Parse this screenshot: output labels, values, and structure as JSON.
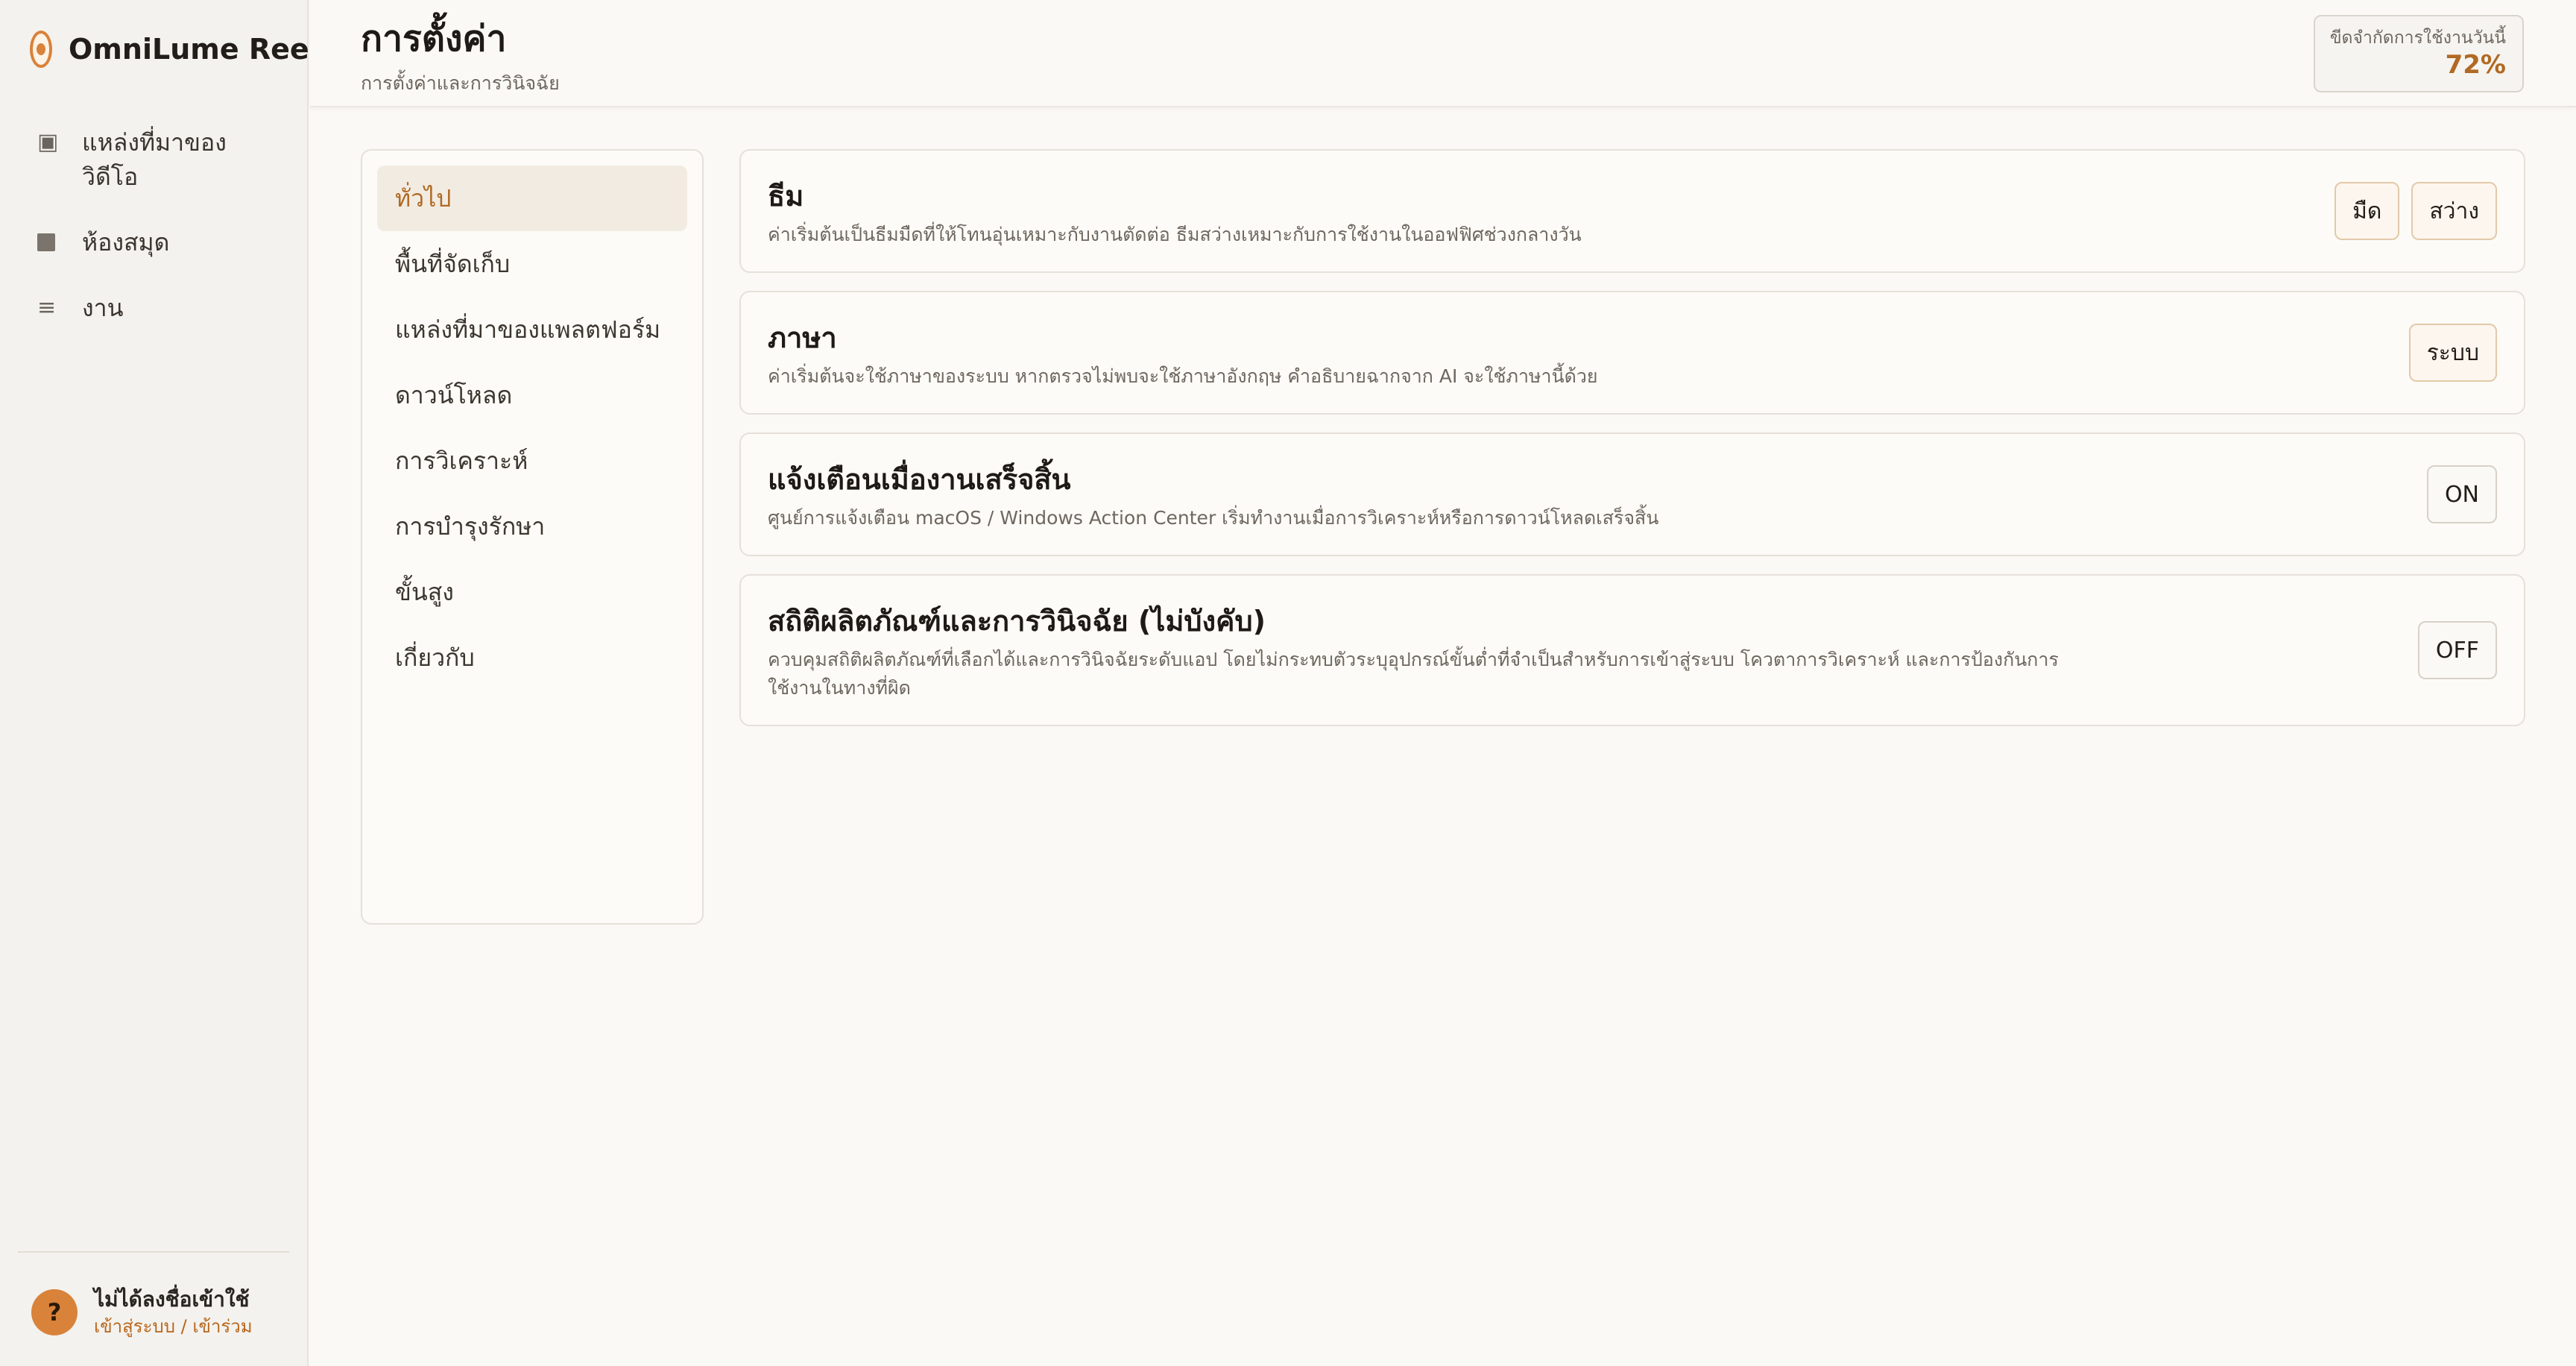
{
  "app": {
    "name": "OmniLume Reel"
  },
  "sidebar": {
    "items": [
      {
        "label": "แหล่งที่มาของวิดีโอ",
        "icon": "video-source-icon"
      },
      {
        "label": "ห้องสมุด",
        "icon": "library-icon"
      },
      {
        "label": "งาน",
        "icon": "tasks-icon"
      }
    ],
    "user": {
      "avatar": "?",
      "name": "ไม่ได้ลงชื่อเข้าใช้",
      "link": "เข้าสู่ระบบ / เข้าร่วม"
    }
  },
  "header": {
    "title": "การตั้งค่า",
    "subtitle": "การตั้งค่าและการวินิจฉัย",
    "quota_label": "ขีดจำกัดการใช้งานวันนี้",
    "quota_value": "72%"
  },
  "settings_nav": {
    "items": [
      "ทั่วไป",
      "พื้นที่จัดเก็บ",
      "แหล่งที่มาของแพลตฟอร์ม",
      "ดาวน์โหลด",
      "การวิเคราะห์",
      "การบำรุงรักษา",
      "ขั้นสูง",
      "เกี่ยวกับ"
    ],
    "active": "ทั่วไป"
  },
  "cards": {
    "theme": {
      "title": "ธีม",
      "desc": "ค่าเริ่มต้นเป็นธีมมืดที่ให้โทนอุ่นเหมาะกับงานตัดต่อ ธีมสว่างเหมาะกับการใช้งานในออฟฟิศช่วงกลางวัน",
      "options": [
        "มืด",
        "สว่าง"
      ]
    },
    "language": {
      "title": "ภาษา",
      "desc": "ค่าเริ่มต้นจะใช้ภาษาของระบบ หากตรวจไม่พบจะใช้ภาษาอังกฤษ คำอธิบายฉากจาก AI จะใช้ภาษานี้ด้วย",
      "value": "ระบบ"
    },
    "notify": {
      "title": "แจ้งเตือนเมื่องานเสร็จสิ้น",
      "desc": "ศูนย์การแจ้งเตือน macOS / Windows Action Center เริ่มทำงานเมื่อการวิเคราะห์หรือการดาวน์โหลดเสร็จสิ้น",
      "state": "ON"
    },
    "telemetry": {
      "title": "สถิติผลิตภัณฑ์และการวินิจฉัย (ไม่บังคับ)",
      "desc": "ควบคุมสถิติผลิตภัณฑ์ที่เลือกได้และการวินิจฉัยระดับแอป โดยไม่กระทบตัวระบุอุปกรณ์ขั้นต่ำที่จำเป็นสำหรับการเข้าสู่ระบบ โควตาการวิเคราะห์ และการป้องกันการใช้งานในทางที่ผิด",
      "state": "OFF"
    }
  },
  "colors": {
    "accent": "#d9823a",
    "accent_text": "#b06a24",
    "background": "#faf9f6"
  }
}
